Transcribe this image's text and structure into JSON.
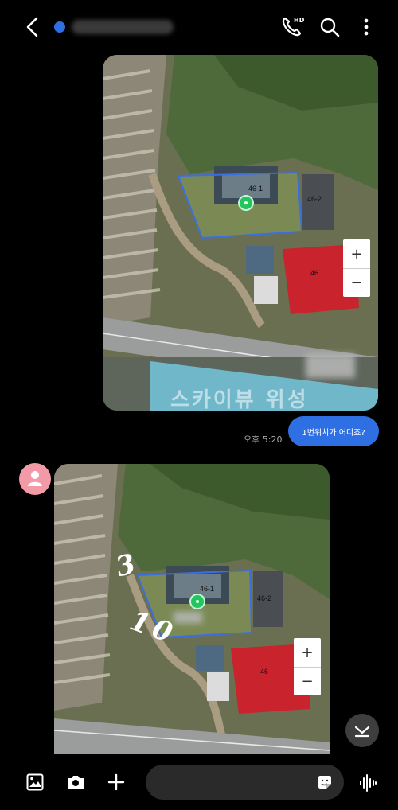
{
  "header": {
    "contact_name": "",
    "call_badge": "HD"
  },
  "messages": {
    "sent_text": "1번위치가 어디죠?",
    "sent_time": "오후 5:20"
  },
  "map1": {
    "parcels": [
      "46-1",
      "46-2",
      "46"
    ],
    "watermark": "스카이뷰 위성"
  },
  "map2": {
    "parcels": [
      "46-1",
      "46-2",
      "46"
    ],
    "handwriting": [
      "3",
      "10"
    ]
  },
  "zoom": {
    "plus": "+",
    "minus": "−"
  },
  "colors": {
    "bubble": "#2f6fe4",
    "pin": "#22c55e",
    "parcel_outline": "#3b6fe0",
    "roof": "#c9232e",
    "avatar": "#f29aa7"
  },
  "icons": [
    "back-icon",
    "call-icon",
    "search-icon",
    "more-icon",
    "gallery-icon",
    "camera-icon",
    "plus-icon",
    "sticker-icon",
    "voice-icon",
    "chevron-down-icon"
  ]
}
